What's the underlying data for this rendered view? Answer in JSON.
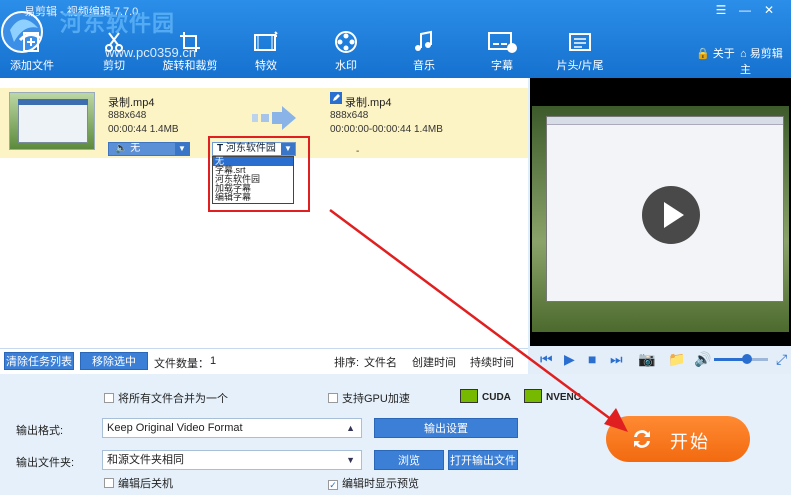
{
  "window": {
    "title": "易剪辑 - 视频编辑 7.7.0",
    "watermark": "河东软件园",
    "watermark_url": "www.pc0359.cn"
  },
  "toolbar": {
    "items": [
      {
        "label": "添加文件",
        "icon": "add-file-icon"
      },
      {
        "label": "剪切",
        "icon": "scissors-icon"
      },
      {
        "label": "旋转和裁剪",
        "icon": "crop-icon"
      },
      {
        "label": "特效",
        "icon": "film-effects-icon"
      },
      {
        "label": "水印",
        "icon": "film-reel-icon"
      },
      {
        "label": "音乐",
        "icon": "music-note-icon"
      },
      {
        "label": "字幕",
        "icon": "subtitle-icon"
      },
      {
        "label": "片头/片尾",
        "icon": "titles-icon"
      }
    ],
    "about": "关于",
    "home": "易剪辑主"
  },
  "task": {
    "source_name": "录制.mp4",
    "source_res": "888x648",
    "source_meta": "00:00:44  1.4MB",
    "output_name": "录制.mp4",
    "output_res": "888x648",
    "output_meta": "00:00:00-00:00:44  1.4MB",
    "audio_value": "无",
    "subtitle_value": "河东软件园",
    "subtitle_options": [
      "无",
      "字幕.srt",
      "河东软件园",
      "加载字幕",
      "编辑字幕"
    ],
    "dash": "-"
  },
  "task_bar": {
    "clear": "清除任务列表",
    "remove": "移除选中",
    "count_label": "文件数量：",
    "count": "1",
    "sort_label": "排序:",
    "sort_name": "文件名",
    "sort_created": "创建时间",
    "sort_duration": "持续时间"
  },
  "settings": {
    "merge": "将所有文件合并为一个",
    "gpu": "支持GPU加速",
    "cuda": "CUDA",
    "nvenc": "NVENC",
    "format_label": "输出格式:",
    "format_value": "Keep Original Video Format",
    "output_settings": "输出设置",
    "folder_label": "输出文件夹:",
    "folder_value": "和源文件夹相同",
    "browse": "浏览",
    "open_folder": "打开输出文件",
    "shutdown": "编辑后关机",
    "preview": "编辑时显示预览",
    "preview_checked": "✓"
  },
  "start": {
    "label": "开始"
  },
  "player": {
    "volume": 0.62
  }
}
